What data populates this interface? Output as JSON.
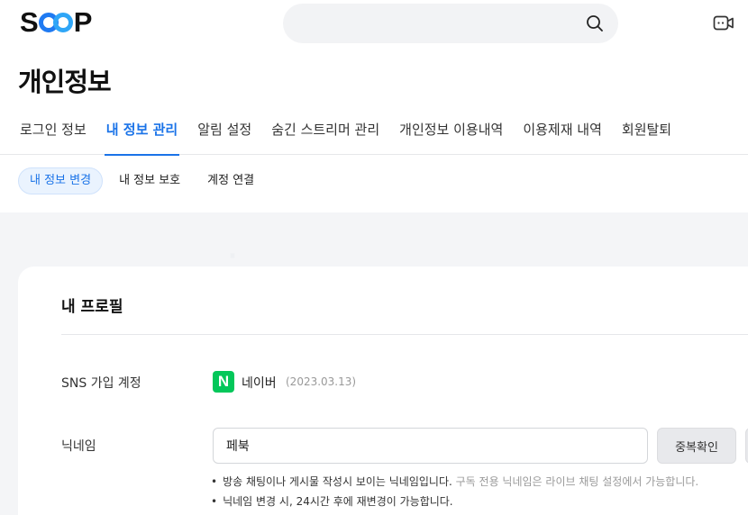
{
  "header": {
    "logo": {
      "part1": "S",
      "part2": "P"
    },
    "search": {
      "value": "",
      "placeholder": ""
    }
  },
  "page_title": "개인정보",
  "tabs": [
    {
      "label": "로그인 정보",
      "active": false
    },
    {
      "label": "내 정보 관리",
      "active": true
    },
    {
      "label": "알림 설정",
      "active": false
    },
    {
      "label": "숨긴 스트리머 관리",
      "active": false
    },
    {
      "label": "개인정보 이용내역",
      "active": false
    },
    {
      "label": "이용제재 내역",
      "active": false
    },
    {
      "label": "회원탈퇴",
      "active": false
    }
  ],
  "subtabs": [
    {
      "label": "내 정보 변경",
      "active": true
    },
    {
      "label": "내 정보 보호",
      "active": false
    },
    {
      "label": "계정 연결",
      "active": false
    }
  ],
  "profile": {
    "title": "내 프로필",
    "sns": {
      "label": "SNS 가입 계정",
      "badge": "N",
      "provider": "네이버",
      "date": "(2023.03.13)"
    },
    "nickname": {
      "label": "닉네임",
      "value": "페북",
      "button": "중복확인",
      "notes": [
        {
          "main": "방송 채팅이나 게시물 작성시 보이는 닉네임입니다.",
          "sub": "구독 전용 닉네임은 라이브 채팅 설정에서 가능합니다."
        },
        {
          "main": "닉네임 변경 시, 24시간 후에 재변경이 가능합니다.",
          "sub": ""
        }
      ]
    }
  },
  "colors": {
    "accent": "#1a73e8",
    "naver": "#03c75a",
    "background": "#f4f5f7"
  },
  "icons": {
    "search": "search-icon",
    "live": "live-camera-icon"
  }
}
